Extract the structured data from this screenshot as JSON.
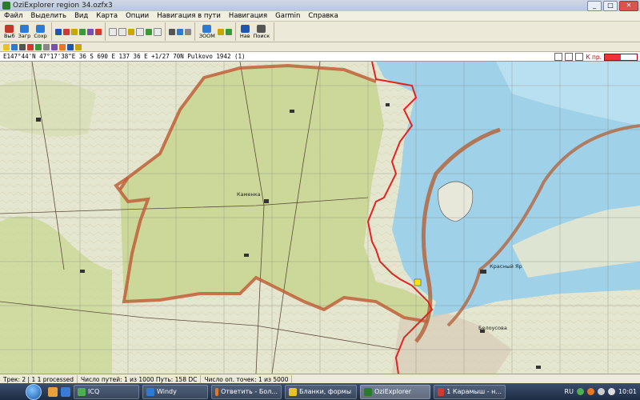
{
  "window": {
    "title": "OziExplorer   region 34.ozfx3",
    "minimize": "_",
    "maximize": "□",
    "close": "✕"
  },
  "menu": [
    "Файл",
    "Выделить",
    "Вид",
    "Карта",
    "Опции",
    "Навигация в пути",
    "Навигация",
    "Garmin",
    "Справка"
  ],
  "toolbar": {
    "buttons": [
      {
        "label": "Выб",
        "icon": "select-icon",
        "color": "#c0392b"
      },
      {
        "label": "Загр",
        "icon": "load-icon",
        "color": "#2e7bd6"
      },
      {
        "label": "Сохр",
        "icon": "save-icon",
        "color": "#2e7bd6"
      },
      {
        "label": "",
        "icon": "waypoint-icon",
        "color": "#1e56b0"
      },
      {
        "label": "",
        "icon": "track-icon",
        "color": "#d13b2f"
      },
      {
        "label": "",
        "icon": "route-icon",
        "color": "#c6a800"
      },
      {
        "label": "",
        "icon": "event-icon",
        "color": "#3a9a3a"
      },
      {
        "label": "ЗООМ",
        "icon": "zoom-icon",
        "color": "#2e7bd6"
      },
      {
        "label": "Нав",
        "icon": "navigate-icon",
        "color": "#1e56b0"
      },
      {
        "label": "Поиск",
        "icon": "find-icon",
        "color": "#555555"
      }
    ]
  },
  "coord_bar": {
    "text": "E147°44'N  47°17'38\"E  36 S 690  E 137 36 E  +1/27 70N  Pulkovo 1942 (1)",
    "right_label": "К пр."
  },
  "map": {
    "labels": [
      "Красный Яр",
      "Каменка",
      "Белоусова"
    ],
    "colors": {
      "land": "#e4e6cf",
      "relief_green": "#c8d58f",
      "water": "#9fd2e8",
      "boundary": "#c0603a",
      "track": "#e52222",
      "grid": "#7a7a7a"
    }
  },
  "status": {
    "a": "Трек: 2 | 1 1 processed",
    "b": "Число путей: 1 из 1000  Путь: 158 DC",
    "c": "Число оп. точек: 1 из 5000"
  },
  "taskbar": {
    "items": [
      {
        "label": "ICQ",
        "color": "#4caf50"
      },
      {
        "label": "Windy",
        "color": "#2e7bd6"
      },
      {
        "label": "Ответить - Бол...",
        "color": "#e87722"
      },
      {
        "label": "Бланки, формы",
        "color": "#e8c422"
      },
      {
        "label": "OziExplorer",
        "color": "#2a7c2a"
      },
      {
        "label": "1 Карамыш - н...",
        "color": "#d13b2f"
      }
    ],
    "lang": "RU",
    "time": "10:01"
  }
}
